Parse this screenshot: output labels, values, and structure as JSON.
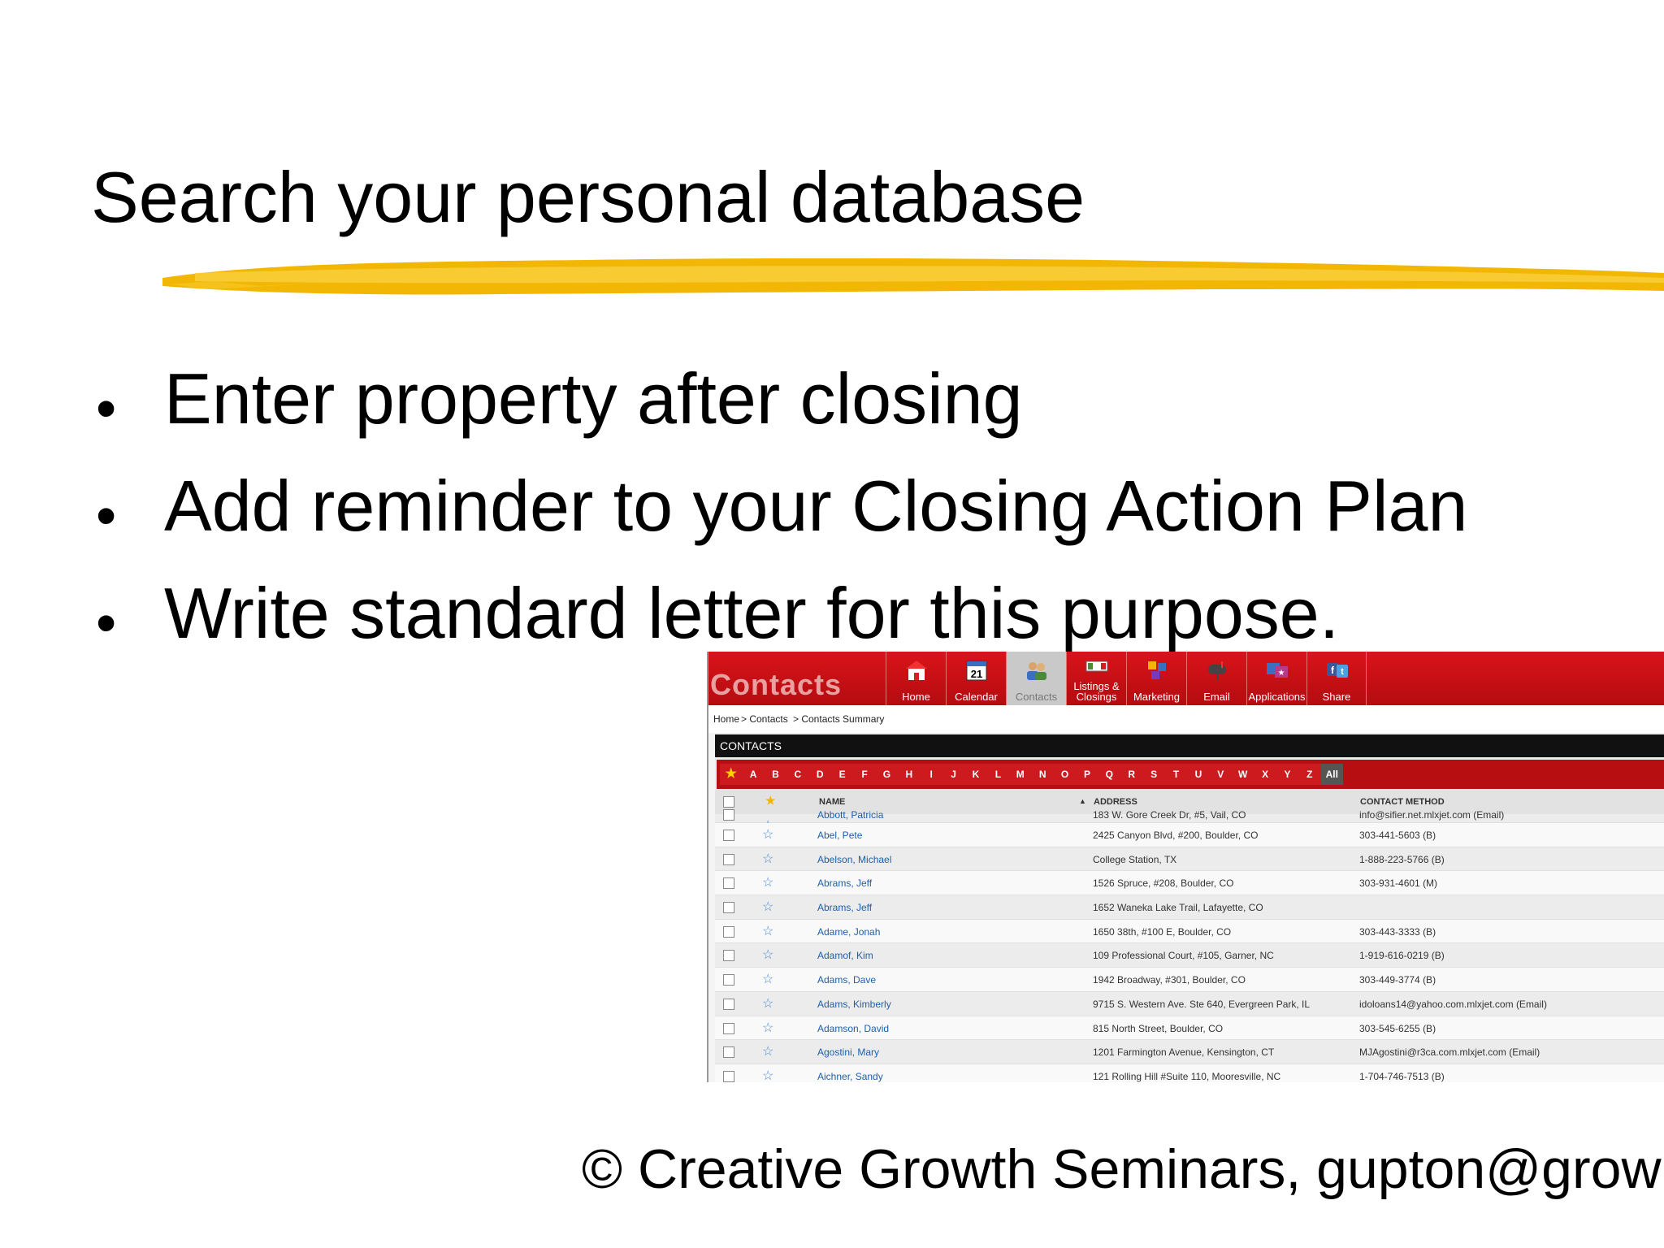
{
  "slide": {
    "title": "Search your personal database",
    "bullets": [
      "Enter property after closing",
      "Add reminder to your Closing Action Plan",
      "Write standard letter for this purpose."
    ],
    "bullet_char": "•",
    "footer": "© Creative Growth Seminars, gupton@grow",
    "accent_color": "#f2b705"
  },
  "app": {
    "title": "Contacts",
    "nav": [
      {
        "label": "Home",
        "icon": "home-icon"
      },
      {
        "label": "Calendar",
        "icon": "calendar-icon",
        "day": "21"
      },
      {
        "label": "Contacts",
        "icon": "contacts-icon",
        "active": true
      },
      {
        "label": "Listings &",
        "label2": "Closings",
        "icon": "listings-icon"
      },
      {
        "label": "Marketing",
        "icon": "marketing-icon"
      },
      {
        "label": "Email",
        "icon": "mailbox-icon"
      },
      {
        "label": "Applications",
        "icon": "applications-icon"
      },
      {
        "label": "Share",
        "icon": "share-icon"
      }
    ],
    "breadcrumb": [
      "Home",
      "> Contacts",
      "> Contacts Summary"
    ],
    "section_title": "CONTACTS",
    "alphabet": [
      "★",
      "A",
      "B",
      "C",
      "D",
      "E",
      "F",
      "G",
      "H",
      "I",
      "J",
      "K",
      "L",
      "M",
      "N",
      "O",
      "P",
      "Q",
      "R",
      "S",
      "T",
      "U",
      "V",
      "W",
      "X",
      "Y",
      "Z",
      "All"
    ],
    "columns": {
      "name": "NAME",
      "sort_icon": "▲",
      "address": "ADDRESS",
      "contact": "CONTACT METHOD",
      "star": "★"
    },
    "rows": [
      {
        "name": "Abbott, Patricia",
        "address": "183 W. Gore Creek Dr, #5, Vail, CO",
        "contact": "info@sifier.net.mlxjet.com (Email)"
      },
      {
        "name": "Abel, Pete",
        "address": "2425 Canyon Blvd, #200, Boulder, CO",
        "contact": "303-441-5603 (B)"
      },
      {
        "name": "Abelson, Michael",
        "address": "College Station, TX",
        "contact": "1-888-223-5766 (B)"
      },
      {
        "name": "Abrams, Jeff",
        "address": "1526 Spruce, #208, Boulder, CO",
        "contact": "303-931-4601 (M)"
      },
      {
        "name": "Abrams, Jeff",
        "address": "1652 Waneka Lake Trail, Lafayette, CO",
        "contact": ""
      },
      {
        "name": "Adame, Jonah",
        "address": "1650 38th, #100 E, Boulder, CO",
        "contact": "303-443-3333 (B)"
      },
      {
        "name": "Adamof, Kim",
        "address": "109 Professional Court, #105, Garner, NC",
        "contact": "1-919-616-0219 (B)"
      },
      {
        "name": "Adams, Dave",
        "address": "1942 Broadway, #301, Boulder, CO",
        "contact": "303-449-3774 (B)"
      },
      {
        "name": "Adams, Kimberly",
        "address": "9715 S. Western Ave. Ste 640, Evergreen Park, IL",
        "contact": "idoloans14@yahoo.com.mlxjet.com (Email)"
      },
      {
        "name": "Adamson, David",
        "address": "815 North Street, Boulder, CO",
        "contact": "303-545-6255 (B)"
      },
      {
        "name": "Agostini, Mary",
        "address": "1201 Farmington Avenue, Kensington, CT",
        "contact": "MJAgostini@r3ca.com.mlxjet.com (Email)"
      },
      {
        "name": "Aichner, Sandy",
        "address": "121 Rolling Hill #Suite 110, Mooresville, NC",
        "contact": "1-704-746-7513 (B)"
      }
    ],
    "colors": {
      "header_red": "#c8101a",
      "link_blue": "#1f5fa8",
      "star_yellow": "#ffd200"
    }
  }
}
